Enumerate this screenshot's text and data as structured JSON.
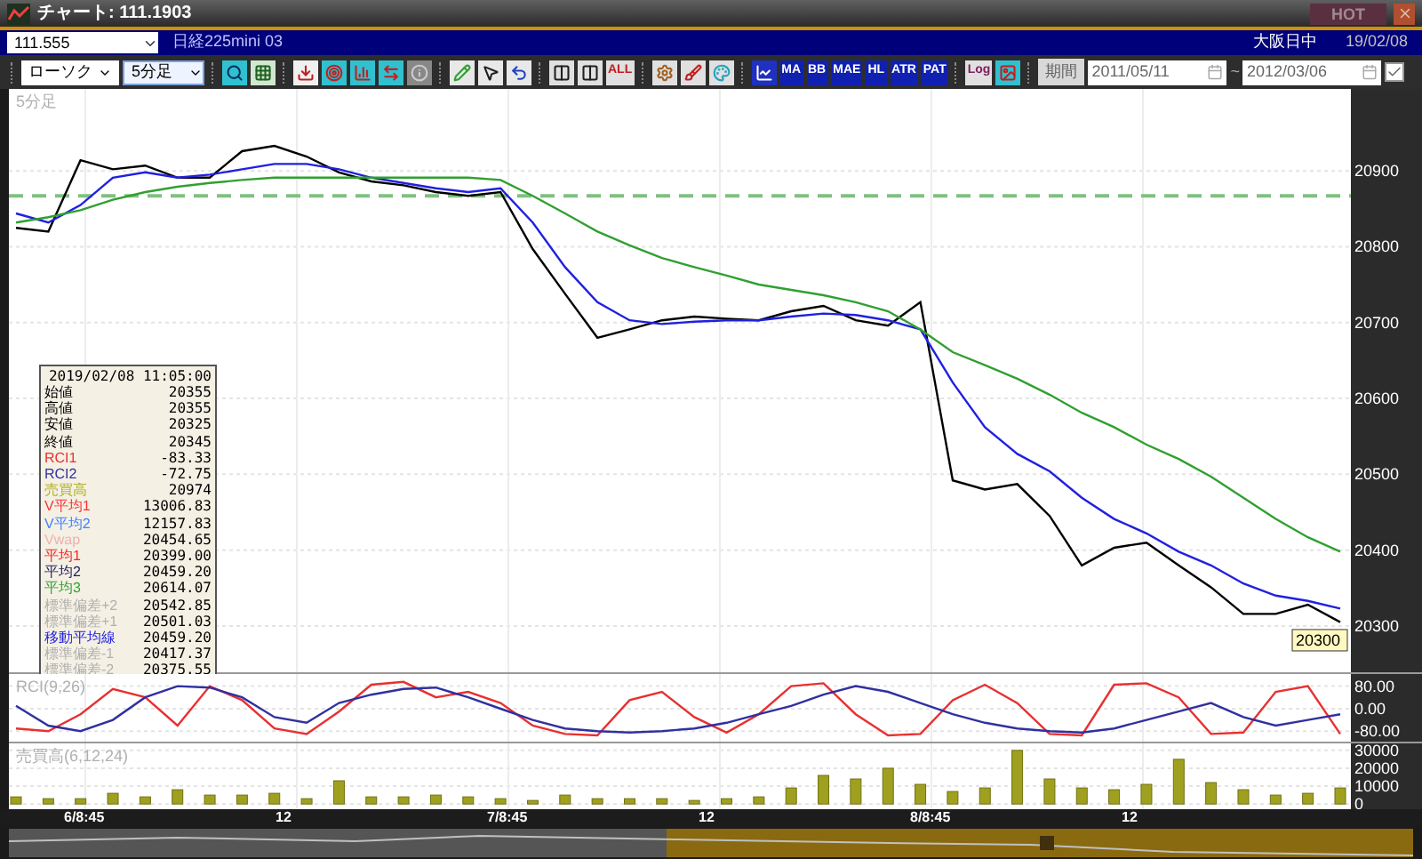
{
  "window": {
    "title": "チャート: 111.1903",
    "hot_label": "HOT"
  },
  "symbol_bar": {
    "code": "111.555",
    "name": "日経225mini 03",
    "session": "大阪日中",
    "date": "19/02/08"
  },
  "toolbar": {
    "chart_type": "ローソク",
    "interval": "5分足",
    "all_button": "ALL",
    "indicator_buttons": [
      "MA",
      "BB",
      "MAE",
      "HL",
      "ATR",
      "PAT"
    ],
    "log_button": "Log",
    "period_button": "期間",
    "date_from": "2011/05/11",
    "date_sep": "~",
    "date_to": "2012/03/06",
    "range_checked": true
  },
  "main_chart": {
    "label": "5分足",
    "price_tag": "20300",
    "chart_data": {
      "type": "line",
      "grid": true,
      "ylim": [
        20239,
        21008
      ],
      "yticks": [
        {
          "value": 20300,
          "label": "20300"
        },
        {
          "value": 20400,
          "label": "20400"
        },
        {
          "value": 20500,
          "label": "20500"
        },
        {
          "value": 20600,
          "label": "20600"
        },
        {
          "value": 20700,
          "label": "20700"
        },
        {
          "value": 20800,
          "label": "20800"
        },
        {
          "value": 20900,
          "label": "20900"
        }
      ],
      "series": [
        {
          "color": "#000000",
          "values": [
            20825,
            20820,
            20914,
            20902,
            20907,
            20891,
            20891,
            20926,
            20933,
            20919,
            20898,
            20886,
            20881,
            20872,
            20867,
            20872,
            20797,
            20738,
            20680,
            20691,
            20703,
            20708,
            20705,
            20703,
            20715,
            20722,
            20703,
            20696,
            20727,
            20492,
            20480,
            20487,
            20445,
            20380,
            20403,
            20410,
            20380,
            20351,
            20316,
            20316,
            20328,
            20305
          ]
        },
        {
          "color": "#2020e0",
          "values": [
            20844,
            20832,
            20855,
            20891,
            20898,
            20891,
            20895,
            20902,
            20909,
            20909,
            20902,
            20891,
            20884,
            20877,
            20872,
            20877,
            20832,
            20773,
            20727,
            20703,
            20698,
            20701,
            20703,
            20703,
            20708,
            20712,
            20710,
            20703,
            20691,
            20621,
            20562,
            20527,
            20504,
            20469,
            20441,
            20422,
            20398,
            20380,
            20356,
            20340,
            20333,
            20323
          ]
        },
        {
          "color": "#30a030",
          "values": [
            20832,
            20839,
            20848,
            20862,
            20872,
            20879,
            20884,
            20888,
            20891,
            20891,
            20891,
            20891,
            20891,
            20891,
            20891,
            20888,
            20867,
            20844,
            20820,
            20802,
            20785,
            20773,
            20762,
            20750,
            20743,
            20736,
            20727,
            20715,
            20691,
            20661,
            20644,
            20626,
            20605,
            20581,
            20562,
            20539,
            20520,
            20497,
            20469,
            20441,
            20417,
            20398
          ]
        }
      ],
      "ref_lines": [
        {
          "axis": "y",
          "value": 20867
        }
      ]
    }
  },
  "info_panel": {
    "header": "2019/02/08  11:05:00",
    "rows": [
      {
        "label": "始値",
        "value": "20355",
        "color": "#000000"
      },
      {
        "label": "高値",
        "value": "20355",
        "color": "#000000"
      },
      {
        "label": "安値",
        "value": "20325",
        "color": "#000000"
      },
      {
        "label": "終値",
        "value": "20345",
        "color": "#000000"
      },
      {
        "label": "RCI1",
        "value": "-83.33",
        "color": "#e83030"
      },
      {
        "label": "RCI2",
        "value": "-72.75",
        "color": "#3030a0"
      },
      {
        "label": "売買高",
        "value": "20974",
        "color": "#b0b020"
      },
      {
        "label": "V平均1",
        "value": "13006.83",
        "color": "#ff3030"
      },
      {
        "label": "V平均2",
        "value": "12157.83",
        "color": "#4080ff"
      },
      {
        "label": "Vwap",
        "value": "20454.65",
        "color": "#f0b0b0"
      },
      {
        "label": "平均1",
        "value": "20399.00",
        "color": "#ff2020"
      },
      {
        "label": "平均2",
        "value": "20459.20",
        "color": "#202060"
      },
      {
        "label": "平均3",
        "value": "20614.07",
        "color": "#30a030"
      },
      {
        "label": "標準偏差+2",
        "value": "20542.85",
        "color": "#b0b0b0"
      },
      {
        "label": "標準偏差+1",
        "value": "20501.03",
        "color": "#b0b0b0"
      },
      {
        "label": "移動平均線",
        "value": "20459.20",
        "color": "#2020e0"
      },
      {
        "label": "標準偏差-1",
        "value": "20417.37",
        "color": "#b0b0b0"
      },
      {
        "label": "標準偏差-2",
        "value": "20375.55",
        "color": "#b0b0b0"
      }
    ]
  },
  "rci_panel": {
    "label": "RCI(9,26)",
    "chart_data": {
      "type": "line",
      "grid": true,
      "ylim": [
        -117,
        123
      ],
      "yticks": [
        {
          "value": 80,
          "label": "80.00"
        },
        {
          "value": 0,
          "label": "0.00"
        },
        {
          "value": -80,
          "label": "-80.00"
        }
      ],
      "series": [
        {
          "color": "#e83030",
          "values": [
            -70,
            -80,
            -20,
            70,
            40,
            -60,
            80,
            30,
            -70,
            -90,
            -10,
            85,
            95,
            40,
            60,
            20,
            -60,
            -90,
            -95,
            30,
            60,
            -30,
            -85,
            -20,
            80,
            90,
            -20,
            -95,
            -90,
            30,
            85,
            20,
            -90,
            -95,
            85,
            90,
            40,
            -90,
            -85,
            60,
            80,
            -90
          ]
        },
        {
          "color": "#3030a0",
          "values": [
            10,
            -60,
            -80,
            -40,
            40,
            80,
            75,
            40,
            -30,
            -50,
            20,
            50,
            70,
            75,
            40,
            0,
            -40,
            -70,
            -80,
            -85,
            -80,
            -70,
            -50,
            -20,
            10,
            50,
            80,
            60,
            20,
            -20,
            -50,
            -70,
            -80,
            -85,
            -70,
            -40,
            -10,
            20,
            -30,
            -60,
            -40,
            -20
          ]
        }
      ]
    }
  },
  "volume_panel": {
    "label": "売買高(6,12,24)",
    "chart_data": {
      "type": "bar",
      "grid": true,
      "ylim": [
        -2900,
        33900
      ],
      "yticks": [
        {
          "value": 0,
          "label": "0"
        },
        {
          "value": 10000,
          "label": "10000"
        },
        {
          "value": 20000,
          "label": "20000"
        },
        {
          "value": 30000,
          "label": "30000"
        }
      ],
      "series": [
        {
          "color": "#a0a020",
          "values": [
            4000,
            3000,
            3000,
            6000,
            4000,
            8000,
            5000,
            5000,
            6000,
            3000,
            13000,
            4000,
            4000,
            5000,
            4000,
            3000,
            2000,
            5000,
            3000,
            3000,
            3000,
            2000,
            3000,
            4000,
            9000,
            16000,
            14000,
            20000,
            11000,
            7000,
            9000,
            30000,
            14000,
            9000,
            8000,
            11000,
            25000,
            12000,
            8000,
            5000,
            6000,
            9000
          ]
        }
      ]
    }
  },
  "time_axis": {
    "labels": [
      "6/8:45",
      "12",
      "7/8:45",
      "12",
      "8/8:45",
      "12"
    ]
  }
}
